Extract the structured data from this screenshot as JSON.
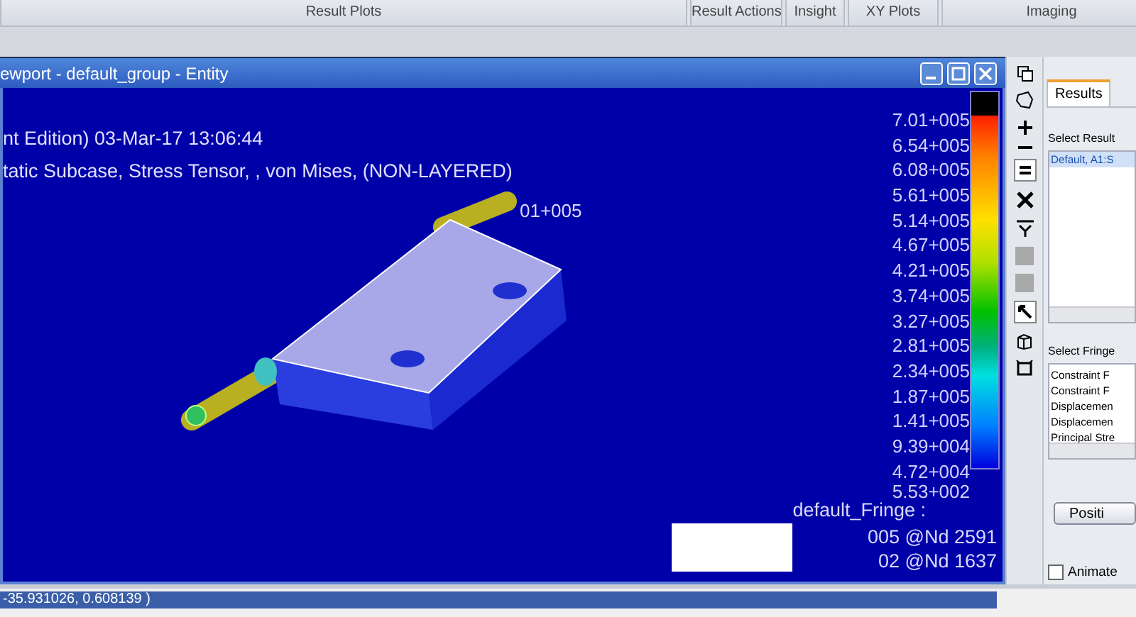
{
  "ribbon_groups": [
    {
      "label": "Result Plots"
    },
    {
      "label": "Result Actions"
    },
    {
      "label": "Insight"
    },
    {
      "label": "XY Plots"
    },
    {
      "label": "Imaging"
    }
  ],
  "viewport": {
    "title": "ewport - default_group - Entity",
    "header_lines": [
      "nt Edition) 03-Mar-17 13:06:44",
      "tatic Subcase, Stress Tensor, , von Mises, (NON-LAYERED)"
    ],
    "model_label": "01+005",
    "legend_values": [
      "7.01+005",
      "6.54+005",
      "6.08+005",
      "5.61+005",
      "5.14+005",
      "4.67+005",
      "4.21+005",
      "3.74+005",
      "3.27+005",
      "2.81+005",
      "2.34+005",
      "1.87+005",
      "1.41+005",
      "9.39+004",
      "4.72+004",
      "5.53+002"
    ],
    "fringe_title": "default_Fringe :",
    "fringe_lines": [
      "005 @Nd 2591",
      "02 @Nd 1637"
    ]
  },
  "results_panel": {
    "tabs": [
      {
        "label": "Results",
        "selected": true
      }
    ],
    "select_result_label": "Select Result",
    "result_items": [
      {
        "label": "Default, A1:S",
        "selected": true
      }
    ],
    "select_fringe_label": "Select Fringe",
    "fringe_items": [
      {
        "label": "Constraint F",
        "selected": false
      },
      {
        "label": "Constraint F",
        "selected": false
      },
      {
        "label": "Displacemen",
        "selected": false
      },
      {
        "label": "Displacemen",
        "selected": false
      },
      {
        "label": "Principal Stre",
        "selected": false
      }
    ],
    "position_button": "Positi",
    "animate": {
      "label": "Animate",
      "checked": false
    }
  },
  "command_line": {
    "text": "-35.931026, 0.608139 )"
  }
}
